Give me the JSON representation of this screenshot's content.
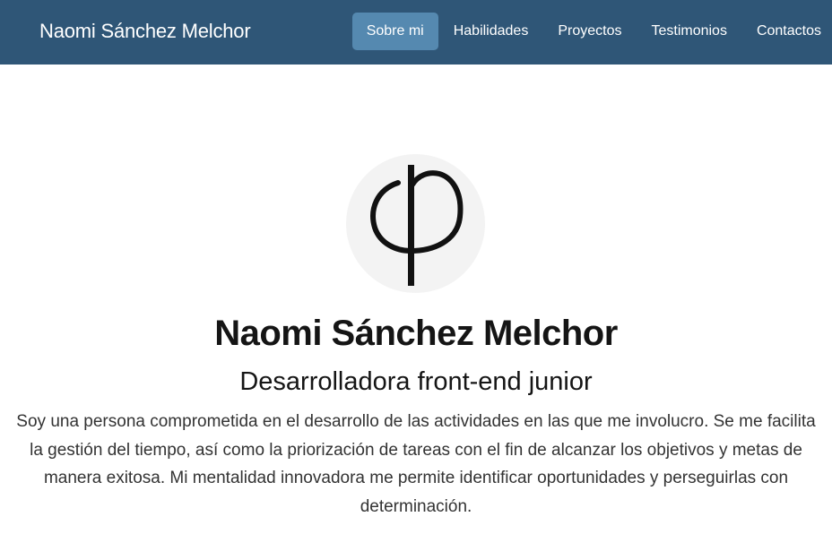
{
  "navbar": {
    "brand": "Naomi Sánchez Melchor",
    "items": [
      {
        "label": "Sobre mi",
        "active": true
      },
      {
        "label": "Habilidades",
        "active": false
      },
      {
        "label": "Proyectos",
        "active": false
      },
      {
        "label": "Testimonios",
        "active": false
      },
      {
        "label": "Contactos",
        "active": false
      }
    ]
  },
  "profile": {
    "avatar_icon": "phi-symbol-icon",
    "name": "Naomi Sánchez Melchor",
    "role": "Desarrolladora front-end junior",
    "bio": "Soy una persona comprometida en el desarrollo de las actividades en las que me involucro. Se me facilita la gestión del tiempo, así como la priorización de tareas con el fin de alcanzar los objetivos y metas de manera exitosa. Mi mentalidad innovadora me permite identificar oportunidades y perseguirlas con determinación."
  },
  "colors": {
    "navbar_bg": "#2f5677",
    "nav_active_bg": "#5589b0",
    "avatar_bg": "#f3f3f3"
  }
}
